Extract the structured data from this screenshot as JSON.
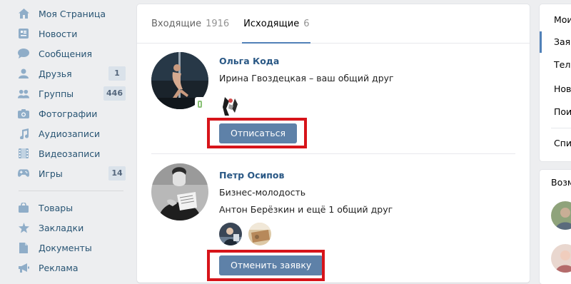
{
  "nav": {
    "items": [
      {
        "label": "Моя Страница",
        "icon": "home-icon"
      },
      {
        "label": "Новости",
        "icon": "news-icon"
      },
      {
        "label": "Сообщения",
        "icon": "messages-icon"
      },
      {
        "label": "Друзья",
        "icon": "friends-icon",
        "count": "1"
      },
      {
        "label": "Группы",
        "icon": "groups-icon",
        "count": "446"
      },
      {
        "label": "Фотографии",
        "icon": "camera-icon"
      },
      {
        "label": "Аудиозаписи",
        "icon": "music-note-icon"
      },
      {
        "label": "Видеозаписи",
        "icon": "film-icon"
      },
      {
        "label": "Игры",
        "icon": "gamepad-icon",
        "count": "14"
      },
      {
        "label": "Товары",
        "icon": "shopping-bag-icon"
      },
      {
        "label": "Закладки",
        "icon": "star-icon"
      },
      {
        "label": "Документы",
        "icon": "document-icon"
      },
      {
        "label": "Реклама",
        "icon": "megaphone-icon"
      }
    ]
  },
  "tabs": [
    {
      "label": "Входящие",
      "count": "1916"
    },
    {
      "label": "Исходящие",
      "count": "6"
    }
  ],
  "requests": [
    {
      "name": "Ольга Кода",
      "line1": "Ирина Гвоздецкая – ваш общий друг",
      "button": "Отписаться"
    },
    {
      "name": "Петр Осипов",
      "line1": "Бизнес-молодость",
      "line2": "Антон Берёзкин и ещё 1 общий друг",
      "button": "Отменить заявку"
    }
  ],
  "right_menu": {
    "items": [
      "Мои",
      "Зая",
      "Теле",
      "Нов",
      "Пои",
      "Спи"
    ]
  },
  "right_box": {
    "title": "Возм"
  },
  "colors": {
    "accent": "#5181b8",
    "button": "#5e81a8",
    "highlight_box": "#d7141a",
    "link": "#2a5885",
    "page_bg": "#edeef0"
  }
}
